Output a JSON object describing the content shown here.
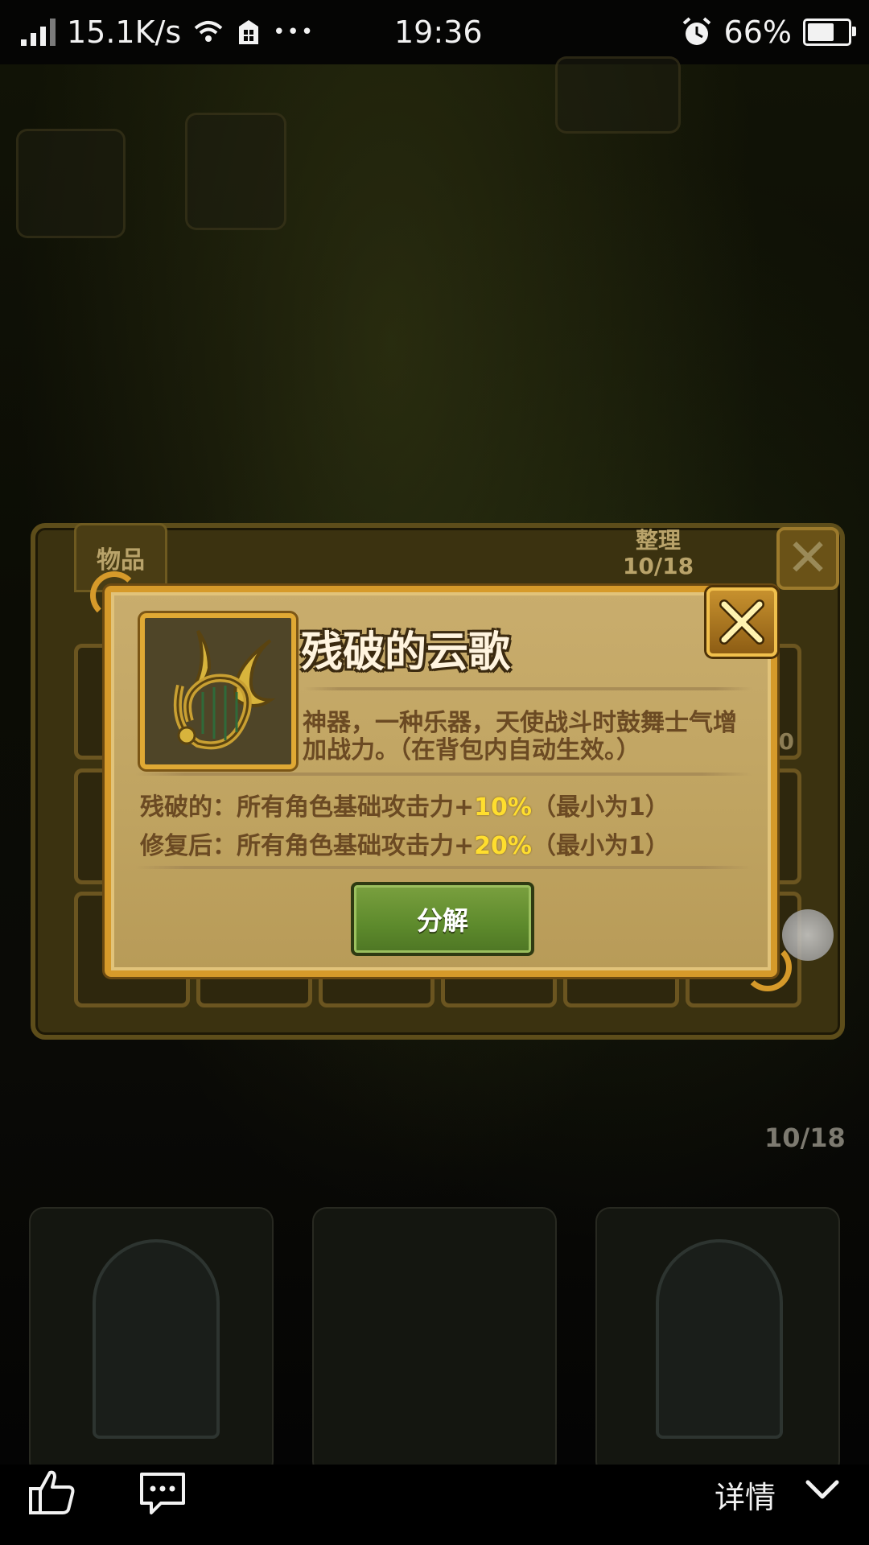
{
  "status_bar": {
    "network_speed": "15.1K/s",
    "time": "19:36",
    "battery": "66%",
    "battery_level": 0.66,
    "more_label": "•••"
  },
  "inventory": {
    "tab_label": "物品",
    "sort_label": "整理",
    "sort_count": "10/18",
    "slot_count": "10",
    "bottom_count": "10/18"
  },
  "item_popup": {
    "title": "残破的云歌",
    "description": "神器，一种乐器，天使战斗时鼓舞士气增加战力。（在背包内自动生效。）",
    "stat1_prefix": "残破的：所有角色基础攻击力+",
    "stat1_value": "10%",
    "stat1_suffix": "（最小为1）",
    "stat2_prefix": "修复后：所有角色基础攻击力+",
    "stat2_value": "20%",
    "stat2_suffix": "（最小为1）",
    "decompose_label": "分解",
    "highlight_color": "#ffde2e",
    "frame_color": "#d69a2a"
  },
  "bottom_bar": {
    "detail_label": "详情",
    "like_icon": "thumbs-up-icon",
    "comment_icon": "comment-icon",
    "expand_icon": "chevron-down-icon"
  }
}
